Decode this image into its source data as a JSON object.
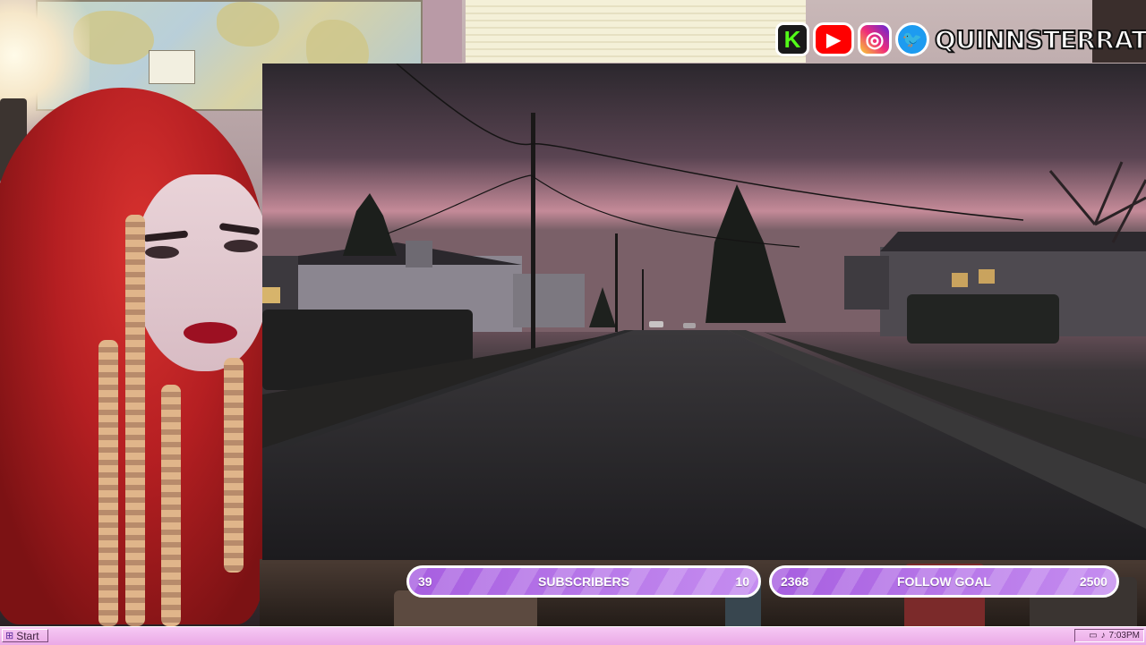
{
  "social": {
    "icons": [
      {
        "name": "kick-icon",
        "glyph": "K"
      },
      {
        "name": "youtube-icon",
        "glyph": "▶"
      },
      {
        "name": "instagram-icon",
        "glyph": "◎"
      },
      {
        "name": "twitter-icon",
        "glyph": "🐦"
      }
    ],
    "handle": "QUINNSTERRAT"
  },
  "goals": {
    "subscribers": {
      "current": "39",
      "label": "SUBSCRIBERS",
      "target": "10"
    },
    "follow": {
      "current": "2368",
      "label": "FOLLOW GOAL",
      "target": "2500"
    }
  },
  "taskbar": {
    "start_label": "Start",
    "start_icon": "windows-logo-icon",
    "tray_icons": [
      "network-icon",
      "volume-icon"
    ],
    "clock": "7:03PM"
  },
  "colors": {
    "goal_bar": "#b56fe6",
    "taskbar": "#f0b8ee",
    "accent_kick": "#53fc18",
    "youtube": "#ff0000",
    "twitter": "#1d9bf0"
  }
}
